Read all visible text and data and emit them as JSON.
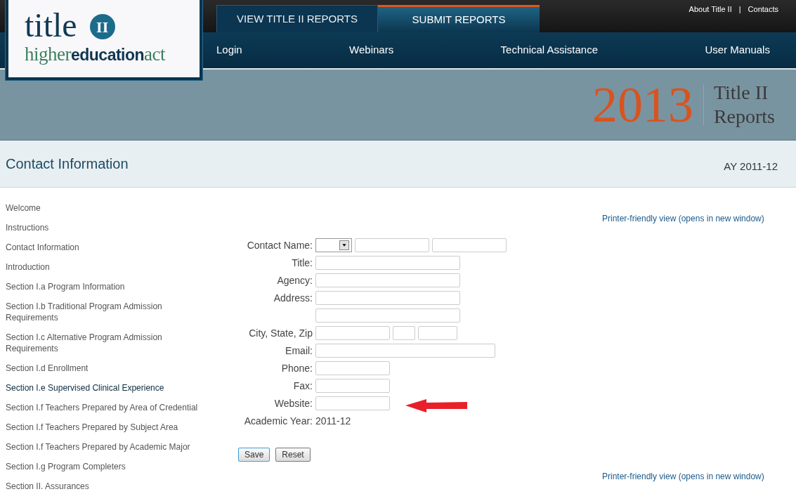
{
  "logo": {
    "title": "title",
    "badge": "II",
    "tagline": "higher**education**act"
  },
  "tabs": [
    {
      "label": "VIEW TITLE II REPORTS",
      "selected": false
    },
    {
      "label": "SUBMIT REPORTS",
      "selected": true
    }
  ],
  "top_links": {
    "links": [
      "About Title II",
      "Contacts"
    ],
    "separator": "|"
  },
  "nav": [
    "Login",
    "Webinars",
    "Technical Assistance",
    "User Manuals"
  ],
  "banner": {
    "year": "2013",
    "title_lines": [
      "Title II",
      "Reports"
    ]
  },
  "page_header": {
    "title": "Contact Information",
    "academic_year": "AY 2011-12"
  },
  "sidebar": {
    "items": [
      {
        "label": "Welcome",
        "selected": false
      },
      {
        "label": "Instructions",
        "selected": false
      },
      {
        "label": "Contact Information",
        "selected": false
      },
      {
        "label": "Introduction",
        "selected": false
      },
      {
        "label": "Section I.a Program Information",
        "selected": false
      },
      {
        "label": "Section I.b Traditional Program Admission Requirements",
        "selected": false
      },
      {
        "label": "Section I.c Alternative Program Admission Requirements",
        "selected": false
      },
      {
        "label": "Section I.d Enrollment",
        "selected": false
      },
      {
        "label": "Section I.e Supervised Clinical Experience",
        "selected": true
      },
      {
        "label": "Section I.f Teachers Prepared by Area of Credential",
        "selected": false
      },
      {
        "label": "Section I.f Teachers Prepared by Subject Area",
        "selected": false
      },
      {
        "label": "Section I.f Teachers Prepared by Academic Major",
        "selected": false
      },
      {
        "label": "Section I.g Program Completers",
        "selected": false
      },
      {
        "label": "Section II. Assurances",
        "selected": false
      }
    ]
  },
  "printer_links": [
    "Printer-friendly view (opens in new window)",
    "Printer-friendly view (opens in new window)"
  ],
  "form": {
    "rows": [
      {
        "label": "Contact Name:",
        "fields": [
          {
            "kind": "select"
          },
          {
            "kind": "short"
          },
          {
            "kind": "short"
          }
        ]
      },
      {
        "label": "Title:",
        "fields": [
          {
            "kind": "long"
          }
        ]
      },
      {
        "label": "Agency:",
        "fields": [
          {
            "kind": "long"
          }
        ]
      },
      {
        "label": "Address:",
        "fields": [
          {
            "kind": "long"
          }
        ]
      },
      {
        "fields": [
          {
            "kind": "long"
          }
        ]
      },
      {
        "label": "City, State, Zip",
        "fields": [
          {
            "kind": "short"
          },
          {
            "kind": "tiny"
          },
          {
            "kind": "zip"
          }
        ]
      },
      {
        "label": "Email:",
        "fields": [
          {
            "kind": "wide"
          }
        ]
      },
      {
        "label": "Phone:",
        "fields": [
          {
            "kind": "short"
          }
        ]
      },
      {
        "label": "Fax:",
        "fields": [
          {
            "kind": "short"
          }
        ]
      },
      {
        "label": "Website:",
        "fields": [
          {
            "kind": "short"
          }
        ],
        "arrow": true
      },
      {
        "label": "Academic Year:",
        "value": "2011-12"
      }
    ],
    "buttons": [
      {
        "label": "Save",
        "selected": true
      },
      {
        "label": "Reset",
        "selected": false
      }
    ]
  }
}
